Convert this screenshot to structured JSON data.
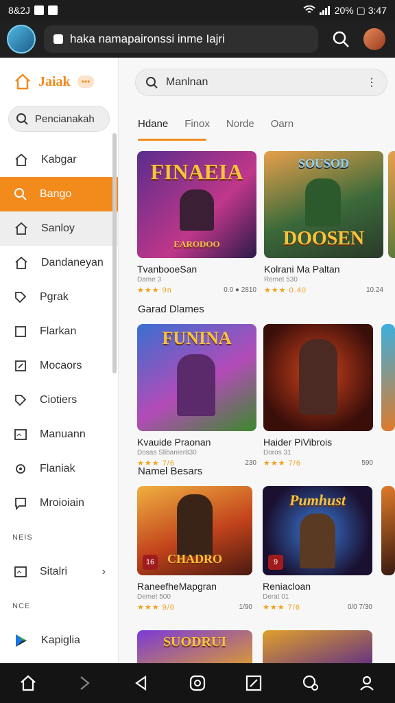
{
  "status": {
    "left": "8&2J",
    "right": "20% ▢ 3:47"
  },
  "browser": {
    "url": "haka namapaironssi inme Iajri"
  },
  "sidebar": {
    "brand": "Jaiak",
    "brand_badge": "•••",
    "search_label": "Pencianakah",
    "items": [
      {
        "label": "Kabgar",
        "icon": "home-icon"
      },
      {
        "label": "Bango",
        "icon": "search-icon",
        "active": true
      },
      {
        "label": "Sanloy",
        "icon": "home-icon",
        "hover": true
      },
      {
        "label": "Dandaneyan",
        "icon": "home-icon"
      },
      {
        "label": "Pgrak",
        "icon": "tag-icon"
      },
      {
        "label": "Flarkan",
        "icon": "square-icon"
      },
      {
        "label": "Mocaors",
        "icon": "edit-icon"
      },
      {
        "label": "Ciotiers",
        "icon": "tag-icon"
      },
      {
        "label": "Manuann",
        "icon": "image-icon"
      },
      {
        "label": "Flaniak",
        "icon": "gear-icon"
      },
      {
        "label": "Mroioiain",
        "icon": "chat-icon"
      }
    ],
    "section1": "NEIS",
    "settings_item": "Sitalri",
    "section2": "NCE",
    "store_item": "Kapiglia"
  },
  "main": {
    "search_placeholder": "Manlnan",
    "tabs": [
      "Hdane",
      "Finox",
      "Norde",
      "Oarn"
    ],
    "section_a": "Garad Dlames",
    "section_b": "Namel Besars",
    "row1": [
      {
        "art": "FINAEIA",
        "art_sub": "EARODOO",
        "title": "TvanbooeSan",
        "sub": "Dame 3",
        "rating": "★★★ 9n",
        "right": "0.0 ● 2810"
      },
      {
        "art": "DOOSEN",
        "art_sub": "SOUSOD",
        "title": "Kolrani Ma Paltan",
        "sub": "Remet 530",
        "rating": "★★★ 0.40",
        "right": "10.24"
      }
    ],
    "row2": [
      {
        "art": "FUNINA",
        "title": "Kvauide Praonan",
        "sub": "Dosas Slibanier830",
        "rating": "★★★ 7/6",
        "right": "230"
      },
      {
        "art": "",
        "title": "Haider PiVibrois",
        "sub": "Doros 31",
        "rating": "★★★ 7/6",
        "right": "590"
      }
    ],
    "row3": [
      {
        "art": "CHADRO",
        "badge": "16",
        "title": "RaneefheMapgran",
        "sub": "Demet 500",
        "rating": "★★★ 9/0",
        "right": "1/90"
      },
      {
        "art": "Pumhust",
        "badge": "9",
        "title": "Reniacloan",
        "sub": "Derat 01",
        "rating": "★★★ 7/6",
        "right": "0/0 7/30"
      }
    ],
    "row4": [
      {
        "art": "SUODRUI"
      },
      {
        "art": ""
      }
    ]
  }
}
